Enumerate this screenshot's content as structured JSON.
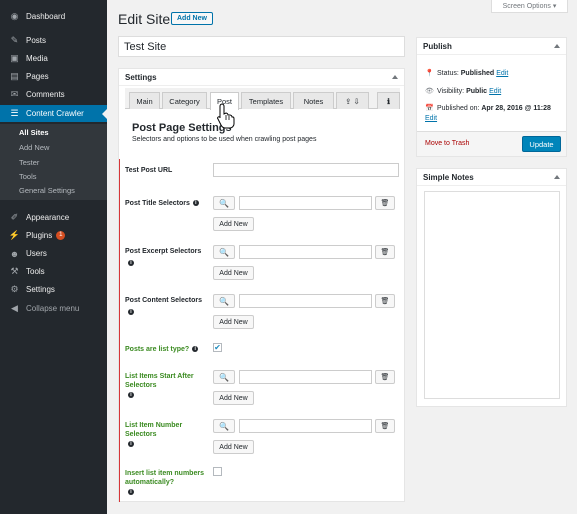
{
  "sidebar": {
    "items": [
      {
        "label": "Dashboard",
        "icon": "dashboard-icon",
        "glyph": "◉"
      },
      {
        "label": "Posts",
        "icon": "pin-icon",
        "glyph": "✎"
      },
      {
        "label": "Media",
        "icon": "media-icon",
        "glyph": "▣"
      },
      {
        "label": "Pages",
        "icon": "page-icon",
        "glyph": "▤"
      },
      {
        "label": "Comments",
        "icon": "comment-icon",
        "glyph": "✉"
      },
      {
        "label": "Content Crawler",
        "icon": "crawler-icon",
        "glyph": "☰"
      },
      {
        "label": "Appearance",
        "icon": "brush-icon",
        "glyph": "✐"
      },
      {
        "label": "Plugins",
        "icon": "plug-icon",
        "glyph": "⚡"
      },
      {
        "label": "Users",
        "icon": "user-icon",
        "glyph": "☻"
      },
      {
        "label": "Tools",
        "icon": "wrench-icon",
        "glyph": "⚒"
      },
      {
        "label": "Settings",
        "icon": "settings-icon",
        "glyph": "⚙"
      },
      {
        "label": "Collapse menu",
        "icon": "collapse-icon",
        "glyph": "◀"
      }
    ],
    "submenu": [
      "All Sites",
      "Add New",
      "Tester",
      "Tools",
      "General Settings"
    ],
    "plugins_badge": "1"
  },
  "screen_options": "Screen Options ▾",
  "header": {
    "title": "Edit Site",
    "add_new": "Add New"
  },
  "post_title": "Test Site",
  "settings_box": {
    "title": "Settings",
    "tabs": [
      "Main",
      "Category",
      "Post",
      "Templates",
      "Notes",
      "⇪ ⇩",
      "ℹ"
    ],
    "active_tab": "Post",
    "section_title": "Post Page Settings",
    "section_desc": "Selectors and options to be used when crawling post pages",
    "fields": {
      "test_url": "Test Post URL",
      "title_sel": "Post Title Selectors",
      "excerpt_sel": "Post Excerpt Selectors",
      "content_sel": "Post Content Selectors",
      "list_type": "Posts are list type?",
      "list_start_1": "List Items Start After",
      "list_start_2": "Selectors",
      "list_num_1": "List Item Number",
      "list_num_2": "Selectors",
      "insert_num_1": "Insert list item numbers",
      "insert_num_2": "automatically?"
    },
    "add_new_label": "Add New",
    "list_type_checked": true,
    "insert_num_checked": false
  },
  "publish": {
    "title": "Publish",
    "status_label": "Status:",
    "status_value": "Published",
    "visibility_label": "Visibility:",
    "visibility_value": "Public",
    "published_label": "Published on:",
    "published_value": "Apr 28, 2016 @ 11:28",
    "edit": "Edit",
    "trash": "Move to Trash",
    "update": "Update"
  },
  "notes": {
    "title": "Simple Notes"
  },
  "colors": {
    "accent": "#0073aa",
    "sidebar": "#23282d",
    "green_label": "#3a8a20",
    "required_line": "#d63638"
  }
}
